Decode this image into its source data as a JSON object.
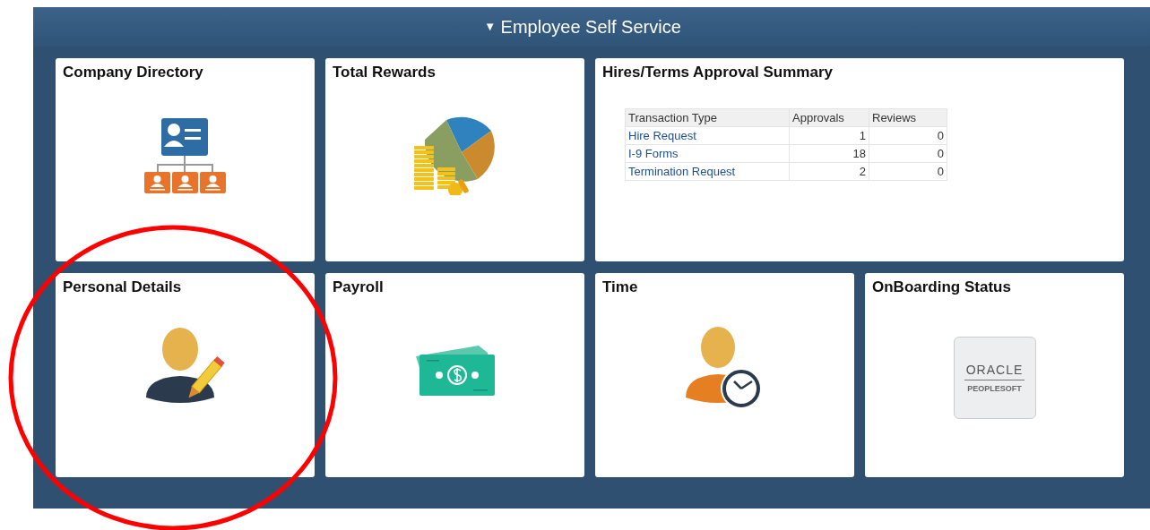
{
  "header": {
    "title": "Employee Self Service",
    "collapse_icon": "▼"
  },
  "tiles": [
    {
      "title": "Company Directory",
      "kind": "directory",
      "highlighted": false
    },
    {
      "title": "Total Rewards",
      "kind": "rewards",
      "highlighted": false
    },
    {
      "title": "Hires/Terms Approval Summary",
      "kind": "summary",
      "highlighted": false,
      "table": {
        "columns": [
          "Transaction Type",
          "Approvals",
          "Reviews"
        ],
        "rows": [
          [
            "Hire Request",
            "1",
            "0"
          ],
          [
            "I-9 Forms",
            "18",
            "0"
          ],
          [
            "Termination Request",
            "2",
            "0"
          ]
        ]
      }
    },
    {
      "title": "Personal Details",
      "kind": "personal",
      "highlighted": true
    },
    {
      "title": "Payroll",
      "kind": "payroll",
      "highlighted": false
    },
    {
      "title": "Time",
      "kind": "time",
      "highlighted": false
    },
    {
      "title": "OnBoarding Status",
      "kind": "logo",
      "highlighted": false,
      "logo": {
        "top": "ORACLE",
        "bottom": "PEOPLESOFT"
      }
    }
  ]
}
